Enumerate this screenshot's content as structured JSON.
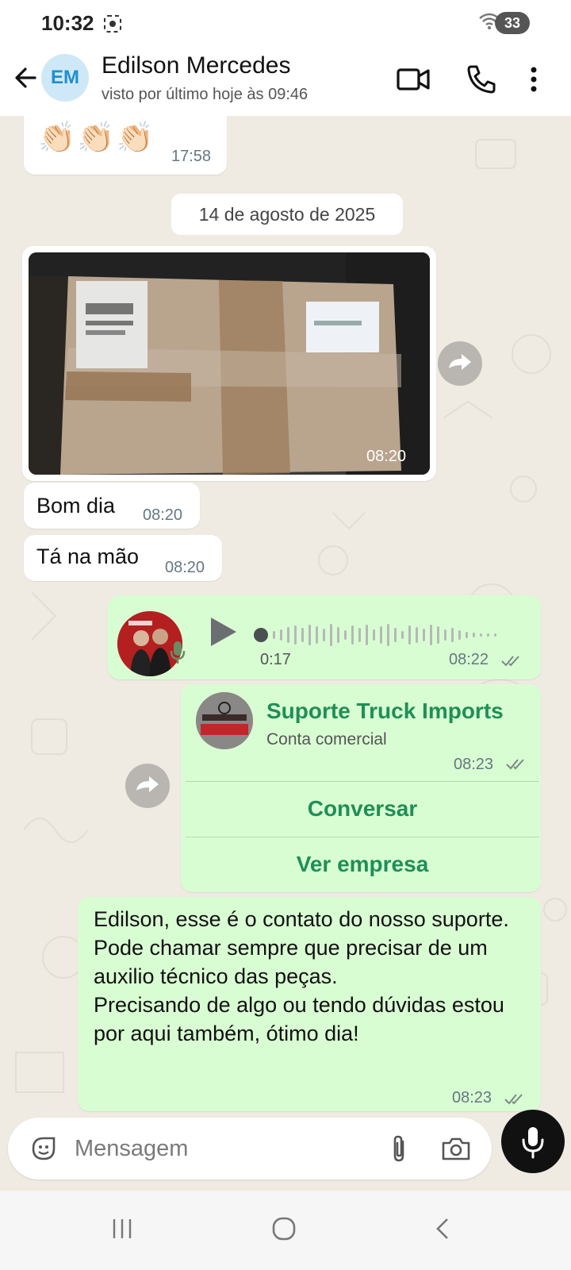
{
  "status_bar": {
    "time": "10:32",
    "battery": "33"
  },
  "header": {
    "avatar_initials": "EM",
    "contact_name": "Edilson Mercedes",
    "contact_status": "visto por último hoje às 09:46"
  },
  "messages": {
    "clap": {
      "emoji": "👏🏻👏🏻👏🏻",
      "time": "17:58"
    },
    "date_separator": "14 de agosto de 2025",
    "photo": {
      "time": "08:20"
    },
    "bom_dia": {
      "text": "Bom dia",
      "time": "08:20"
    },
    "ta_na_mao": {
      "text": "Tá na mão",
      "time": "08:20"
    },
    "voice": {
      "duration": "0:17",
      "time": "08:22"
    },
    "contact_card": {
      "name": "Suporte Truck Imports",
      "subtitle": "Conta comercial",
      "time": "08:23",
      "button_chat": "Conversar",
      "button_business": "Ver empresa"
    },
    "long_message": {
      "line1": "Edilson, esse é o contato do nosso suporte.",
      "line2": "Pode chamar sempre que precisar de um auxilio técnico das peças.",
      "line3": "Precisando de algo ou tendo dúvidas estou por aqui também, ótimo dia!",
      "time": "08:23"
    }
  },
  "input_bar": {
    "placeholder": "Mensagem"
  },
  "colors": {
    "outgoing_bubble": "#d9fdd3",
    "incoming_bubble": "#ffffff",
    "accent_green": "#1f8f56",
    "chat_bg": "#efeae2"
  },
  "icons": [
    "back-arrow-icon",
    "video-call-icon",
    "phone-icon",
    "more-options-icon",
    "forward-icon",
    "play-icon",
    "mic-icon",
    "double-check-icon",
    "sticker-icon",
    "attach-icon",
    "camera-icon",
    "recents-nav-icon",
    "home-nav-icon",
    "back-nav-icon"
  ]
}
